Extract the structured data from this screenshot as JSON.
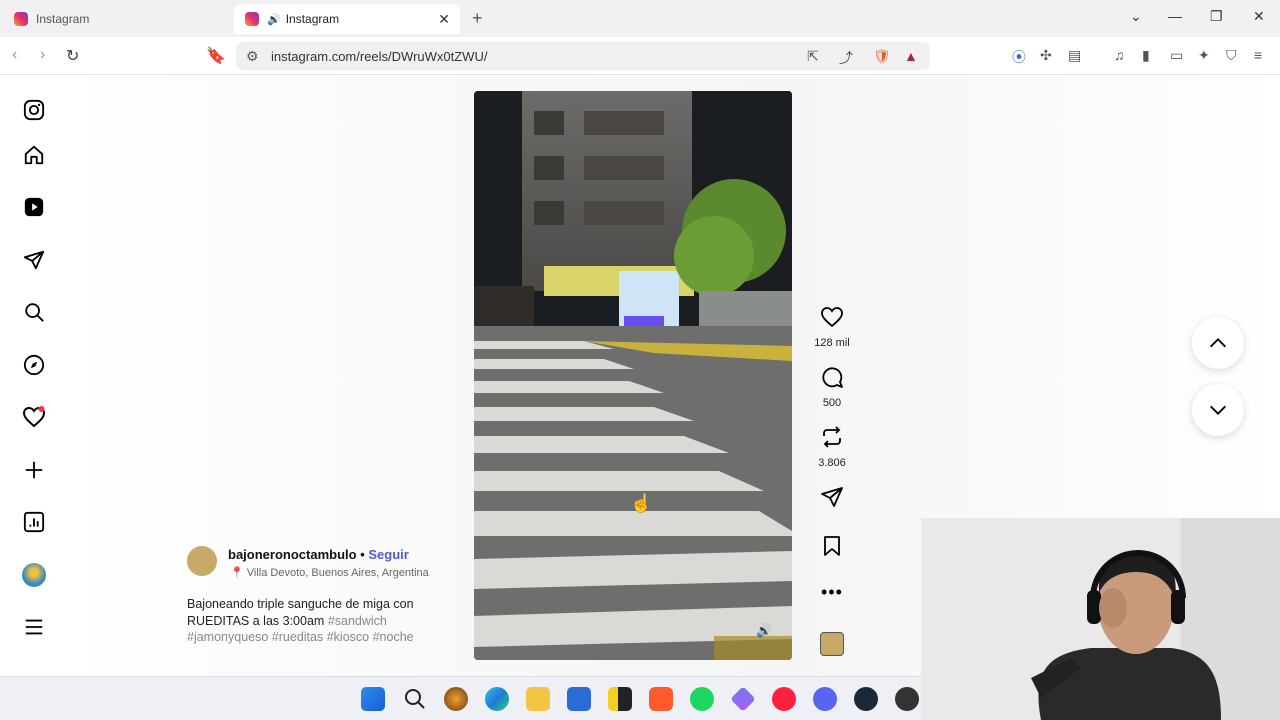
{
  "browser": {
    "tabs": [
      {
        "title": "Instagram",
        "active": false
      },
      {
        "title": "Instagram",
        "active": true,
        "audio": true
      }
    ],
    "url": "instagram.com/reels/DWruWx0tZWU/"
  },
  "sidebar": {
    "items": [
      "instagram-logo",
      "home",
      "reels",
      "messages",
      "search",
      "explore",
      "notifications",
      "create",
      "dashboard",
      "profile",
      "more"
    ]
  },
  "reel": {
    "likes": "128 mil",
    "comments": "500",
    "reposts": "3.806",
    "author": "bajoneronoctambulo",
    "separator": "•",
    "follow_label": "Seguir",
    "location": "Villa Devoto, Buenos Aires, Argentina",
    "caption_text": "Bajoneando triple sanguche de miga con RUEDITAS a las 3:00am",
    "caption_tags": [
      "#sandwich",
      "#jamonyqueso",
      "#rueditas",
      "#kiosco",
      "#noche"
    ]
  },
  "colors": {
    "follow": "#4f5bd5",
    "notification_dot": "#ff3040"
  }
}
